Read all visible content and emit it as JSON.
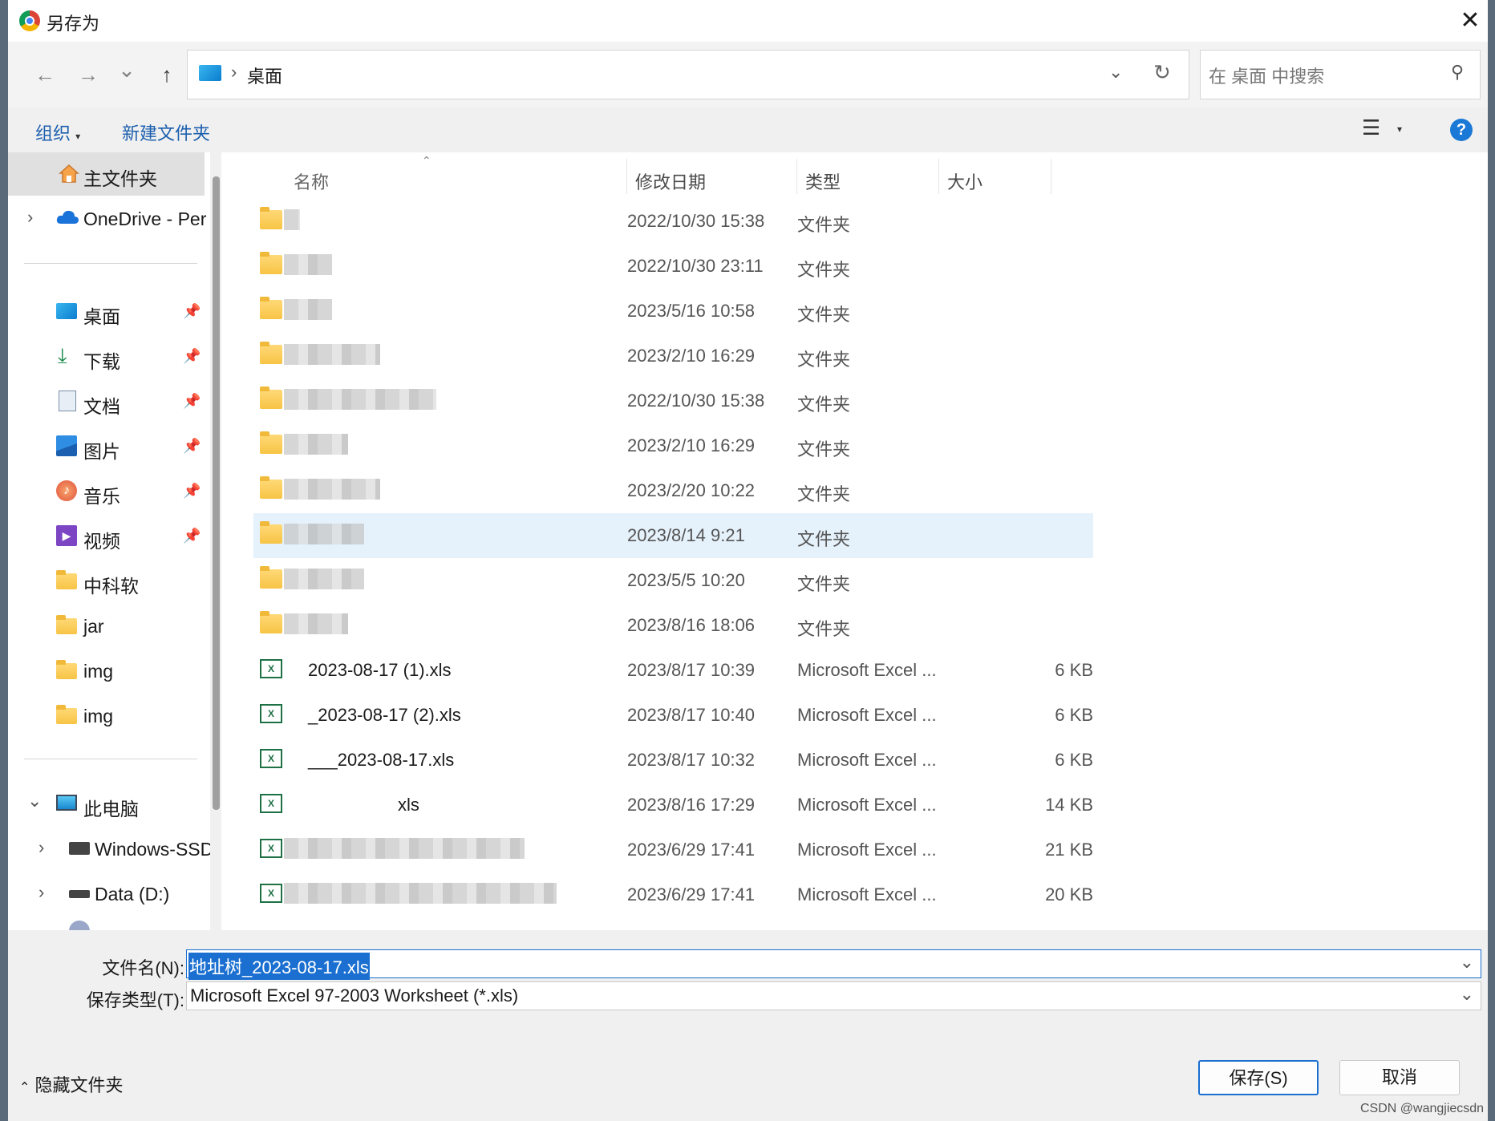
{
  "title": "另存为",
  "nav": {
    "back": "←",
    "forward": "→",
    "recent": "⌄",
    "up": "↑",
    "crumb_sep": "›",
    "location": "桌面",
    "refresh": "↻",
    "search_placeholder": "在 桌面 中搜索"
  },
  "toolbar": {
    "organize": "组织",
    "new_folder": "新建文件夹",
    "help": "?"
  },
  "sidebar": {
    "items": [
      {
        "label": "主文件夹"
      },
      {
        "label": "OneDrive - Per"
      },
      {
        "label": "桌面"
      },
      {
        "label": "下载"
      },
      {
        "label": "文档"
      },
      {
        "label": "图片"
      },
      {
        "label": "音乐"
      },
      {
        "label": "视频"
      },
      {
        "label": "中科软"
      },
      {
        "label": "jar"
      },
      {
        "label": "img"
      },
      {
        "label": "img"
      },
      {
        "label": "此电脑"
      },
      {
        "label": "Windows-SSD"
      },
      {
        "label": "Data (D:)"
      }
    ]
  },
  "columns": {
    "name": "名称",
    "date": "修改日期",
    "type": "类型",
    "size": "大小"
  },
  "files": [
    {
      "date": "2022/10/30 15:38",
      "type": "文件夹",
      "size": ""
    },
    {
      "date": "2022/10/30 23:11",
      "type": "文件夹",
      "size": ""
    },
    {
      "date": "2023/5/16 10:58",
      "type": "文件夹",
      "size": ""
    },
    {
      "date": "2023/2/10 16:29",
      "type": "文件夹",
      "size": ""
    },
    {
      "date": "2022/10/30 15:38",
      "type": "文件夹",
      "size": ""
    },
    {
      "date": "2023/2/10 16:29",
      "type": "文件夹",
      "size": ""
    },
    {
      "date": "2023/2/20 10:22",
      "type": "文件夹",
      "size": ""
    },
    {
      "date": "2023/8/14 9:21",
      "type": "文件夹",
      "size": ""
    },
    {
      "date": "2023/5/5 10:20",
      "type": "文件夹",
      "size": ""
    },
    {
      "date": "2023/8/16 18:06",
      "type": "文件夹",
      "size": ""
    },
    {
      "name": "2023-08-17 (1).xls",
      "date": "2023/8/17 10:39",
      "type": "Microsoft Excel ...",
      "size": "6 KB"
    },
    {
      "name": "_2023-08-17 (2).xls",
      "date": "2023/8/17 10:40",
      "type": "Microsoft Excel ...",
      "size": "6 KB"
    },
    {
      "name": "___2023-08-17.xls",
      "date": "2023/8/17 10:32",
      "type": "Microsoft Excel ...",
      "size": "6 KB"
    },
    {
      "name": "xls",
      "date": "2023/8/16 17:29",
      "type": "Microsoft Excel ...",
      "size": "14 KB"
    },
    {
      "date": "2023/6/29 17:41",
      "type": "Microsoft Excel ...",
      "size": "21 KB"
    },
    {
      "date": "2023/6/29 17:41",
      "type": "Microsoft Excel ...",
      "size": "20 KB"
    }
  ],
  "form": {
    "filename_label": "文件名(N):",
    "filename_value": "地址树_2023-08-17.xls",
    "type_label": "保存类型(T):",
    "type_value": "Microsoft Excel 97-2003 Worksheet (*.xls)"
  },
  "footer": {
    "hide_folders": "隐藏文件夹",
    "save": "保存(S)",
    "cancel": "取消"
  },
  "watermark": "CSDN @wangjiecsdn"
}
